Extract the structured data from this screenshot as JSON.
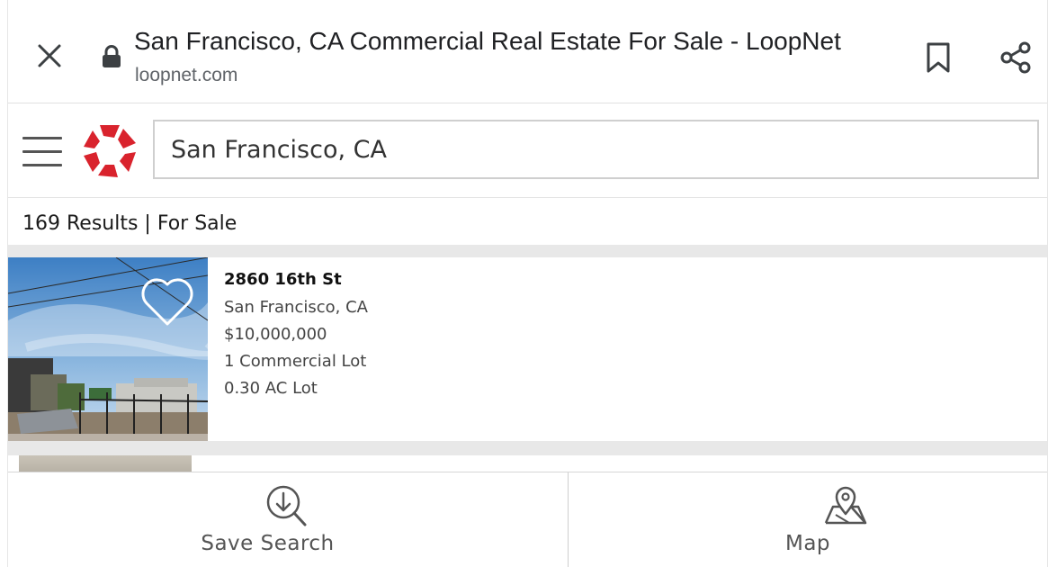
{
  "browser": {
    "title": "San Francisco, CA Commercial Real Estate For Sale - LoopNet",
    "url": "loopnet.com",
    "icons": {
      "close": "close-icon",
      "lock": "lock-icon",
      "bookmark": "bookmark-icon",
      "share": "share-icon"
    }
  },
  "header": {
    "menu_icon": "hamburger-menu-icon",
    "logo": "loopnet-logo",
    "brand_color": "#d9232d",
    "search_value": "San Francisco, CA"
  },
  "results": {
    "summary": "169 Results | For Sale"
  },
  "listings": [
    {
      "address": "2860 16th St",
      "city": "San Francisco, CA",
      "price": "$10,000,000",
      "type": "1 Commercial Lot",
      "size": "0.30 AC Lot"
    }
  ],
  "bottom_bar": {
    "save_search_label": "Save Search",
    "map_label": "Map"
  }
}
